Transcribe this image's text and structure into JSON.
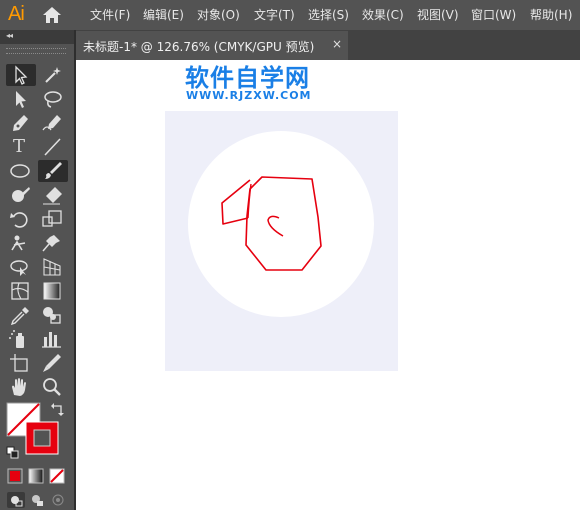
{
  "app": {
    "logo": "Ai"
  },
  "menu": {
    "items": [
      {
        "label": "文件(F)"
      },
      {
        "label": "编辑(E)"
      },
      {
        "label": "对象(O)"
      },
      {
        "label": "文字(T)"
      },
      {
        "label": "选择(S)"
      },
      {
        "label": "效果(C)"
      },
      {
        "label": "视图(V)"
      },
      {
        "label": "窗口(W)"
      },
      {
        "label": "帮助(H)"
      }
    ]
  },
  "panel": {
    "collapse_glyph": "◂◂"
  },
  "document": {
    "tab_title": "未标题-1* @ 126.76% (CMYK/GPU 预览)",
    "close_glyph": "×"
  },
  "watermark": {
    "title": "软件自学网",
    "url": "WWW.RJZXW.COM"
  },
  "tools": {
    "type_glyph": "T"
  },
  "colors": {
    "menubar": "#535353",
    "toolbar": "#535353",
    "artboard": "#eeeff9",
    "stroke": "#e6000f",
    "watermark": "#1a7fe6",
    "logo": "#ff9a00"
  },
  "icons": [
    "home-icon",
    "selection-tool-icon",
    "magic-wand-icon",
    "direct-selection-icon",
    "lasso-icon",
    "pen-icon",
    "curvature-icon",
    "type-tool-icon",
    "line-tool-icon",
    "ellipse-tool-icon",
    "paintbrush-icon",
    "shaper-icon",
    "eraser-icon",
    "rotate-icon",
    "scale-icon",
    "puppet-warp-icon",
    "pin-icon",
    "free-transform-icon",
    "perspective-icon",
    "mesh-icon",
    "gradient-icon",
    "eyedropper-icon",
    "blend-icon",
    "symbol-sprayer-icon",
    "graph-icon",
    "artboard-tool-icon",
    "slice-icon",
    "hand-icon",
    "zoom-icon"
  ]
}
